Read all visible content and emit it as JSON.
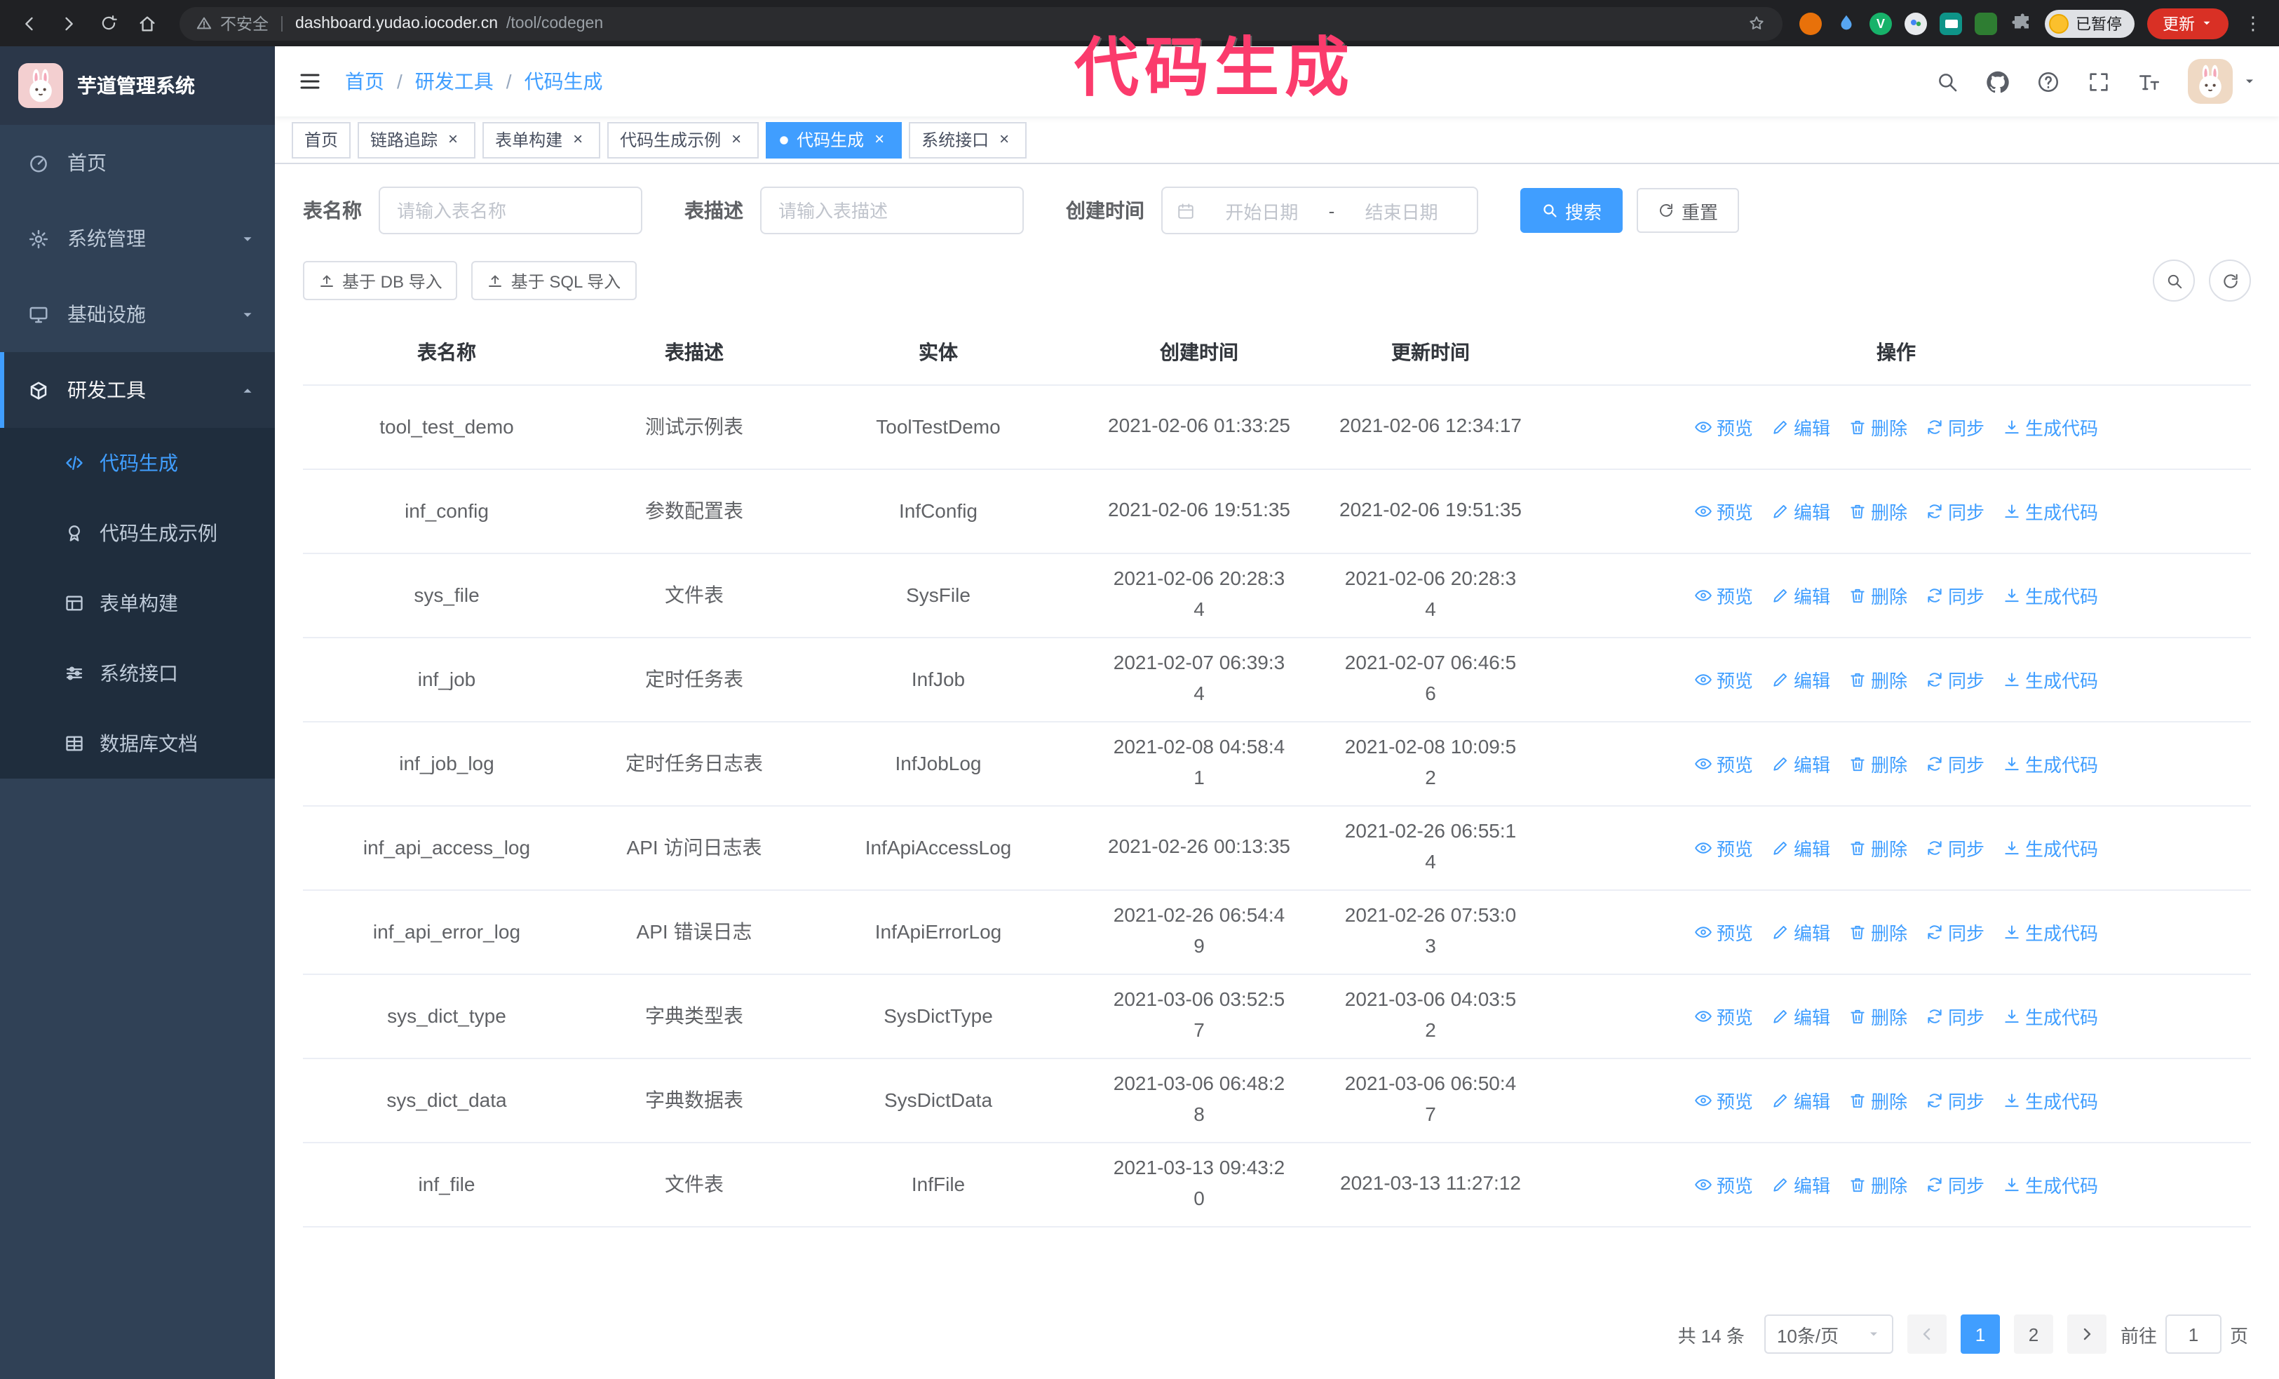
{
  "annotation": {
    "text": "代码生成",
    "color": "#fb3b6c"
  },
  "browser": {
    "security_label": "不安全",
    "url_host": "dashboard.yudao.iocoder.cn",
    "url_path": "/tool/codegen",
    "paused_badge": "已暂停",
    "update_button": "更新"
  },
  "sidebar": {
    "logo_title": "芋道管理系统",
    "items": [
      {
        "label": "首页"
      },
      {
        "label": "系统管理"
      },
      {
        "label": "基础设施"
      },
      {
        "label": "研发工具"
      }
    ],
    "subitems": [
      {
        "label": "代码生成"
      },
      {
        "label": "代码生成示例"
      },
      {
        "label": "表单构建"
      },
      {
        "label": "系统接口"
      },
      {
        "label": "数据库文档"
      }
    ]
  },
  "header": {
    "breadcrumb": {
      "home": "首页",
      "section": "研发工具",
      "current": "代码生成"
    }
  },
  "tabs": [
    {
      "label": "首页"
    },
    {
      "label": "链路追踪"
    },
    {
      "label": "表单构建"
    },
    {
      "label": "代码生成示例"
    },
    {
      "label": "代码生成"
    },
    {
      "label": "系统接口"
    }
  ],
  "filters": {
    "table_name_label": "表名称",
    "table_name_placeholder": "请输入表名称",
    "table_desc_label": "表描述",
    "table_desc_placeholder": "请输入表描述",
    "create_time_label": "创建时间",
    "date_start_placeholder": "开始日期",
    "date_separator": "-",
    "date_end_placeholder": "结束日期",
    "search_button": "搜索",
    "reset_button": "重置"
  },
  "toolbar": {
    "import_db_button": "基于 DB 导入",
    "import_sql_button": "基于 SQL 导入"
  },
  "table": {
    "columns": [
      "表名称",
      "表描述",
      "实体",
      "创建时间",
      "更新时间",
      "操作"
    ],
    "actions": [
      "预览",
      "编辑",
      "删除",
      "同步",
      "生成代码"
    ],
    "rows": [
      {
        "name": "tool_test_demo",
        "desc": "测试示例表",
        "entity": "ToolTestDemo",
        "created": "2021-02-06 01:33:25",
        "updated": "2021-02-06 12:34:17"
      },
      {
        "name": "inf_config",
        "desc": "参数配置表",
        "entity": "InfConfig",
        "created": "2021-02-06 19:51:35",
        "updated": "2021-02-06 19:51:35"
      },
      {
        "name": "sys_file",
        "desc": "文件表",
        "entity": "SysFile",
        "created": "2021-02-06 20:28:3\n4",
        "updated": "2021-02-06 20:28:3\n4"
      },
      {
        "name": "inf_job",
        "desc": "定时任务表",
        "entity": "InfJob",
        "created": "2021-02-07 06:39:3\n4",
        "updated": "2021-02-07 06:46:5\n6"
      },
      {
        "name": "inf_job_log",
        "desc": "定时任务日志表",
        "entity": "InfJobLog",
        "created": "2021-02-08 04:58:4\n1",
        "updated": "2021-02-08 10:09:5\n2"
      },
      {
        "name": "inf_api_access_log",
        "desc": "API 访问日志表",
        "entity": "InfApiAccessLog",
        "created": "2021-02-26 00:13:35",
        "updated": "2021-02-26 06:55:1\n4"
      },
      {
        "name": "inf_api_error_log",
        "desc": "API 错误日志",
        "entity": "InfApiErrorLog",
        "created": "2021-02-26 06:54:4\n9",
        "updated": "2021-02-26 07:53:0\n3"
      },
      {
        "name": "sys_dict_type",
        "desc": "字典类型表",
        "entity": "SysDictType",
        "created": "2021-03-06 03:52:5\n7",
        "updated": "2021-03-06 04:03:5\n2"
      },
      {
        "name": "sys_dict_data",
        "desc": "字典数据表",
        "entity": "SysDictData",
        "created": "2021-03-06 06:48:2\n8",
        "updated": "2021-03-06 06:50:4\n7"
      },
      {
        "name": "inf_file",
        "desc": "文件表",
        "entity": "InfFile",
        "created": "2021-03-13 09:43:2\n0",
        "updated": "2021-03-13 11:27:12"
      }
    ]
  },
  "pagination": {
    "total_text": "共 14 条",
    "page_size_text": "10条/页",
    "page_1": "1",
    "page_2": "2",
    "goto_label": "前往",
    "goto_value": "1",
    "goto_unit": "页"
  },
  "colors": {
    "accent": "#409eff",
    "sidebar_bg": "#304156",
    "submenu_bg": "#1f2d3d"
  }
}
